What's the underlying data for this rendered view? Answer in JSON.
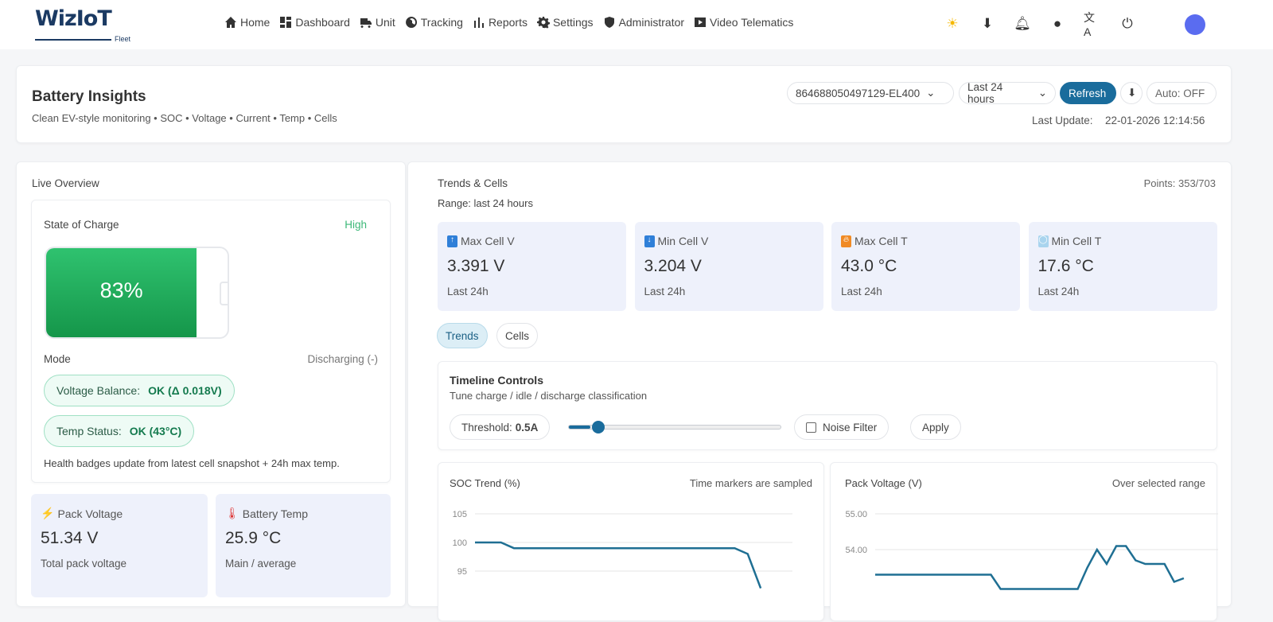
{
  "nav": {
    "logo": "WizIoT",
    "logo_sub": "Fleet",
    "items": [
      {
        "label": "Home",
        "icon": "home-icon"
      },
      {
        "label": "Dashboard",
        "icon": "dashboard-icon"
      },
      {
        "label": "Unit",
        "icon": "truck-icon"
      },
      {
        "label": "Tracking",
        "icon": "globe-icon"
      },
      {
        "label": "Reports",
        "icon": "bar-chart-icon"
      },
      {
        "label": "Settings",
        "icon": "gear-icon"
      },
      {
        "label": "Administrator",
        "icon": "admin-shield-icon"
      },
      {
        "label": "Video Telematics",
        "icon": "video-icon"
      }
    ],
    "right_icons": [
      "sun-icon",
      "download-icon",
      "bell-icon",
      "user-circle-icon",
      "translate-icon",
      "power-icon",
      "bot-avatar"
    ]
  },
  "header": {
    "title": "Battery Insights",
    "subtitle": "Clean EV-style monitoring • SOC • Voltage • Current • Temp • Cells",
    "device": "864688050497129-EL400",
    "range": "Last 24 hours",
    "refresh": "Refresh",
    "auto": "Auto: OFF",
    "last_update_label": "Last Update:",
    "last_update": "22-01-2026 12:14:56"
  },
  "live": {
    "title": "Live Overview",
    "soc_label": "State of Charge",
    "soc_level": "High",
    "soc_value": "83%",
    "soc_percent": 83,
    "mode_label": "Mode",
    "mode_value": "Discharging (-)",
    "badges": [
      {
        "label": "Voltage Balance:",
        "value": "OK (Δ 0.018V)"
      },
      {
        "label": "Temp Status:",
        "value": "OK (43°C)"
      }
    ],
    "note": "Health badges update from latest cell snapshot + 24h max temp.",
    "stats": [
      {
        "title": "Pack Voltage",
        "icon": "lightning-icon",
        "value": "51.34 V",
        "sub": "Total pack voltage"
      },
      {
        "title": "Battery Temp",
        "icon": "thermometer-icon",
        "value": "25.9 °C",
        "sub": "Main / average"
      }
    ]
  },
  "trends": {
    "title": "Trends & Cells",
    "range": "Range: last 24 hours",
    "points": "Points: 353/703",
    "kpis": [
      {
        "title": "Max Cell V",
        "icon": "arrow-up-icon",
        "value": "3.391 V",
        "sub": "Last 24h",
        "color": "#2f7fd8"
      },
      {
        "title": "Min Cell V",
        "icon": "arrow-down-icon",
        "value": "3.204 V",
        "sub": "Last 24h",
        "color": "#2f7fd8"
      },
      {
        "title": "Max Cell T",
        "icon": "fire-icon",
        "value": "43.0 °C",
        "sub": "Last 24h",
        "color": "#f08a24"
      },
      {
        "title": "Min Cell T",
        "icon": "ice-icon",
        "value": "17.6 °C",
        "sub": "Last 24h",
        "color": "#a9d4ee"
      }
    ],
    "tabs": [
      "Trends",
      "Cells"
    ],
    "active_tab": "Trends",
    "timeline": {
      "title": "Timeline Controls",
      "sub": "Tune charge / idle / discharge classification",
      "threshold_label": "Threshold:",
      "threshold_value": "0.5A",
      "slider_fraction": 0.1,
      "noise_filter": "Noise Filter",
      "noise_checked": false,
      "apply": "Apply"
    }
  },
  "chart_data": [
    {
      "type": "line",
      "title": "SOC Trend (%)",
      "note": "Time markers are sampled",
      "yticks": [
        "105",
        "100",
        "95"
      ],
      "ylim": [
        92,
        106
      ],
      "grid": true,
      "color": "#1f6f93",
      "values": [
        100,
        100,
        100,
        99,
        99,
        99,
        99,
        99,
        99,
        99,
        99,
        99,
        99,
        99,
        99,
        99,
        99,
        99,
        99,
        99,
        99,
        98,
        92
      ]
    },
    {
      "type": "line",
      "title": "Pack Voltage (V)",
      "note": "Over selected range",
      "yticks": [
        "55.00",
        "54.00"
      ],
      "ylim": [
        53.1,
        55.2
      ],
      "grid": true,
      "color": "#1f6f93",
      "values": [
        53.3,
        53.3,
        53.3,
        53.3,
        53.3,
        53.3,
        53.3,
        53.3,
        53.3,
        53.3,
        53.3,
        53.3,
        53.3,
        52.9,
        52.9,
        52.9,
        52.9,
        52.9,
        52.9,
        52.9,
        52.9,
        52.9,
        53.5,
        54.0,
        53.6,
        54.1,
        54.1,
        53.7,
        53.6,
        53.6,
        53.6,
        53.1,
        53.2
      ]
    }
  ]
}
